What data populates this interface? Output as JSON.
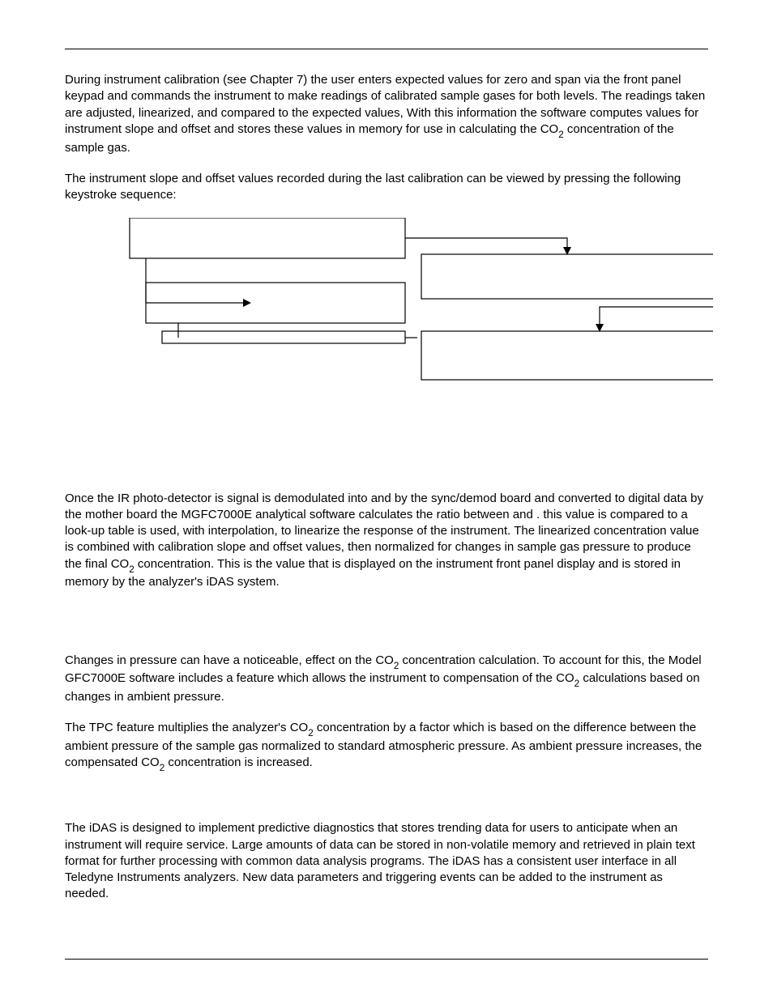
{
  "p1a": "During instrument calibration (see Chapter 7) the user enters expected values for zero and span via the front panel keypad and commands the instrument to make readings of calibrated sample gases for both levels.  The readings taken are adjusted, linearized, and compared to the expected values, With this information the software computes values for instrument slope and offset and stores these values in memory for use in calculating the CO",
  "p1b": " concentration of the sample gas.",
  "p2": "The instrument slope and offset values recorded during the last calibration can be viewed by pressing the following keystroke sequence:",
  "p3a": "Once the IR photo-detector is signal is demodulated into                     and                   by the sync/demod board and converted to digital data by the mother board the MGFC7000E analytical software calculates the ratio between                     and                 . this value is compared to a look-up table is used, with interpolation, to linearize the response of the instrument.  The linearized concentration value is combined with calibration slope and offset values, then normalized for changes in sample gas  pressure to produce the final CO",
  "p3b": " concentration.  This is the value that is displayed on the instrument front panel display and is stored in memory by the analyzer's iDAS system.",
  "p4a": "Changes in pressure can have a noticeable, effect on the CO",
  "p4b": " concentration calculation. To account for this, the Model GFC7000E software includes a feature which allows the instrument to compensation of the CO",
  "p4c": " calculations based on changes in ambient pressure.",
  "p5a": "The TPC feature multiplies the analyzer's CO",
  "p5b": " concentration by a factor which is based on the difference between the ambient pressure of the sample gas normalized to standard atmospheric pressure. As ambient pressure increases, the compensated CO",
  "p5c": " concentration is increased.",
  "p6": "The iDAS is designed to implement predictive diagnostics that stores trending data for users to anticipate when an instrument will require service. Large amounts of data can be stored in non-volatile memory and retrieved in plain text format for further processing with common data analysis programs. The iDAS has a consistent user interface in all Teledyne Instruments analyzers. New data parameters and triggering events can be added to the instrument as needed.",
  "sub2": "2"
}
